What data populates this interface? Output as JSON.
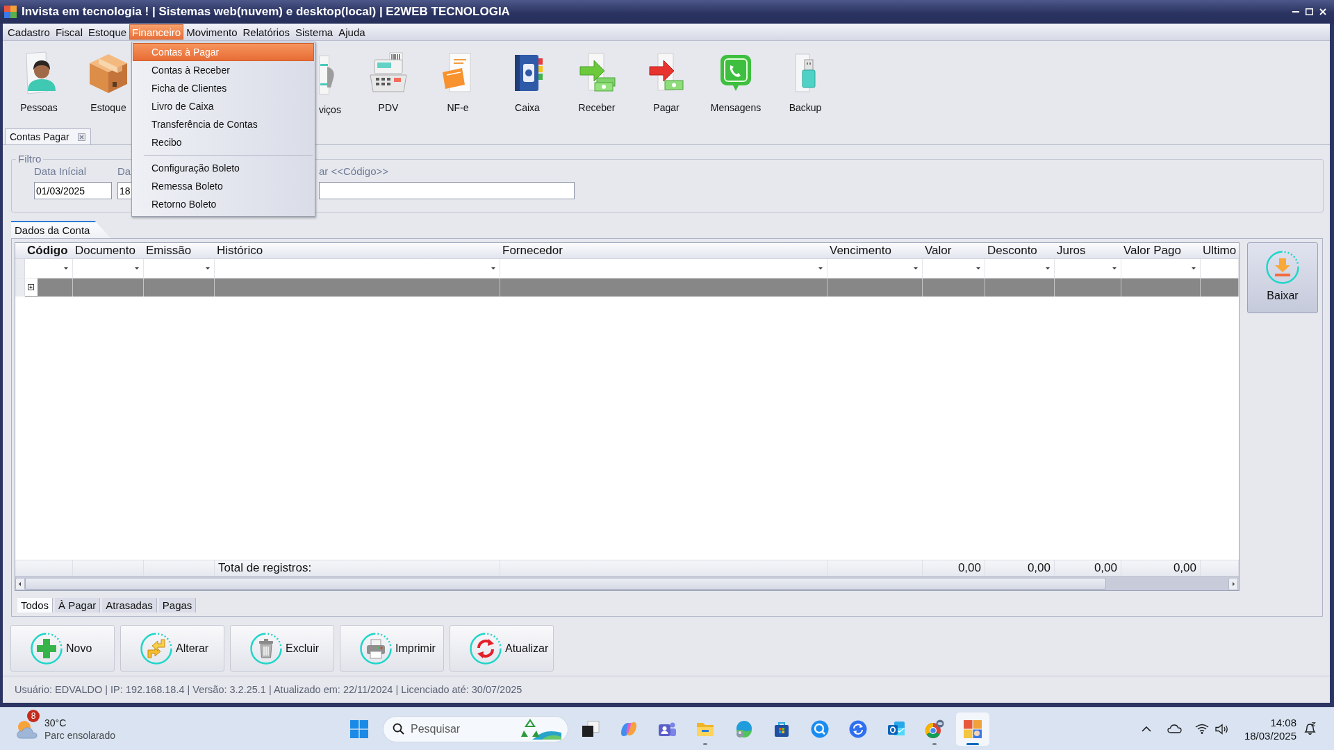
{
  "window": {
    "title": "Invista em tecnologia ! | Sistemas web(nuvem) e desktop(local) | E2WEB TECNOLOGIA"
  },
  "menu": [
    {
      "label": "Cadastro",
      "selected": false
    },
    {
      "label": "Fiscal",
      "selected": false
    },
    {
      "label": "Estoque",
      "selected": false
    },
    {
      "label": "Financeiro",
      "selected": true
    },
    {
      "label": "Movimento",
      "selected": false
    },
    {
      "label": "Relatórios",
      "selected": false
    },
    {
      "label": "Sistema",
      "selected": false
    },
    {
      "label": "Ajuda",
      "selected": false
    }
  ],
  "dropdown": [
    {
      "kind": "item",
      "label": "Contas à Pagar",
      "selected": true
    },
    {
      "kind": "item",
      "label": "Contas à Receber",
      "selected": false
    },
    {
      "kind": "item",
      "label": "Ficha de Clientes",
      "selected": false
    },
    {
      "kind": "item",
      "label": "Livro de Caixa",
      "selected": false
    },
    {
      "kind": "item",
      "label": "Transferência de Contas",
      "selected": false
    },
    {
      "kind": "item",
      "label": "Recibo",
      "selected": false
    },
    {
      "kind": "separator"
    },
    {
      "kind": "item",
      "label": "Configuração Boleto",
      "selected": false
    },
    {
      "kind": "item",
      "label": "Remessa Boleto",
      "selected": false
    },
    {
      "kind": "item",
      "label": "Retorno Boleto",
      "selected": false
    }
  ],
  "toolbar": [
    {
      "kind": "person",
      "label": "Pessoas"
    },
    {
      "kind": "box",
      "label": "Estoque"
    },
    {
      "kind": "partial",
      "label": "viços"
    },
    {
      "kind": "register",
      "label": "PDV"
    },
    {
      "kind": "invoice",
      "label": "NF-e"
    },
    {
      "kind": "book",
      "label": "Caixa"
    },
    {
      "kind": "receive",
      "label": "Receber"
    },
    {
      "kind": "pay",
      "label": "Pagar"
    },
    {
      "kind": "chat",
      "label": "Mensagens"
    },
    {
      "kind": "usb",
      "label": "Backup"
    }
  ],
  "document_tabs": [
    {
      "label": "Contas Pagar",
      "selected": true
    }
  ],
  "filter": {
    "title": "Filtro",
    "fields": [
      {
        "kind": "date",
        "label": "Data Inícial",
        "value": "01/03/2025"
      },
      {
        "kind": "cut",
        "label": "Da",
        "value": "18"
      },
      {
        "kind": "text",
        "label": "ar <<Código>>"
      }
    ]
  },
  "data_tabs": [
    {
      "label": "Dados da Conta",
      "selected": true
    }
  ],
  "table": {
    "columns": [
      {
        "label": "Código",
        "emphasized": true,
        "filter": true
      },
      {
        "label": "Documento",
        "emphasized": false,
        "filter": true
      },
      {
        "label": "Emissão",
        "emphasized": false,
        "filter": true
      },
      {
        "label": "Histórico",
        "emphasized": false,
        "filter": true,
        "footer": {
          "kind": "label",
          "value": "Total de registros:"
        }
      },
      {
        "label": "Fornecedor",
        "emphasized": false,
        "filter": true
      },
      {
        "label": "Vencimento",
        "emphasized": false,
        "filter": true
      },
      {
        "label": "Valor",
        "emphasized": false,
        "filter": true,
        "footer": {
          "kind": "sum",
          "value": "0,00"
        }
      },
      {
        "label": "Desconto",
        "emphasized": false,
        "filter": true,
        "footer": {
          "kind": "sum",
          "value": "0,00"
        }
      },
      {
        "label": "Juros",
        "emphasized": false,
        "filter": true,
        "footer": {
          "kind": "sum",
          "value": "0,00"
        }
      },
      {
        "label": "Valor Pago",
        "emphasized": false,
        "filter": true,
        "footer": {
          "kind": "sum",
          "value": "0,00"
        }
      },
      {
        "label": "Ultimo",
        "emphasized": false,
        "filter": false
      }
    ],
    "rows": [
      {
        "selected": true,
        "expanded": false
      }
    ]
  },
  "side_button": {
    "label": "Baixar"
  },
  "status_tabs": [
    {
      "label": "Todos",
      "selected": true
    },
    {
      "label": "À Pagar",
      "selected": false
    },
    {
      "label": "Atrasadas",
      "selected": false
    },
    {
      "label": "Pagas",
      "selected": false
    }
  ],
  "buttons": [
    {
      "kind": "add",
      "label": "Novo"
    },
    {
      "kind": "edit",
      "label": "Alterar"
    },
    {
      "kind": "delete",
      "label": "Excluir"
    },
    {
      "kind": "print",
      "label": "Imprimir"
    },
    {
      "kind": "refresh",
      "label": "Atualizar"
    }
  ],
  "status_bar": {
    "text": "Usuário: EDVALDO | IP: 192.168.18.4 | Versão: 3.2.25.1 | Atualizado em: 22/11/2024 | Licenciado até: 30/07/2025"
  },
  "taskbar": {
    "weather": {
      "badge": "8",
      "temperature": "30°C",
      "condition": "Parc ensolarado"
    },
    "search": {
      "placeholder": "Pesquisar"
    },
    "apps": [
      {
        "kind": "squares",
        "running": false,
        "selected": false
      },
      {
        "kind": "ribbon",
        "running": false,
        "selected": false
      },
      {
        "kind": "people",
        "running": false,
        "selected": false
      },
      {
        "kind": "folder",
        "running": true,
        "selected": false
      },
      {
        "kind": "swirl",
        "running": false,
        "selected": false
      },
      {
        "kind": "bag",
        "running": false,
        "selected": false
      },
      {
        "kind": "magnifier",
        "running": false,
        "selected": false
      },
      {
        "kind": "arrows",
        "running": false,
        "selected": false
      },
      {
        "kind": "envelope",
        "running": false,
        "selected": false
      },
      {
        "kind": "wheel",
        "running": true,
        "selected": false
      },
      {
        "kind": "puzzle",
        "running": true,
        "selected": true
      }
    ],
    "clock": {
      "time": "14:08",
      "date": "18/03/2025"
    }
  }
}
